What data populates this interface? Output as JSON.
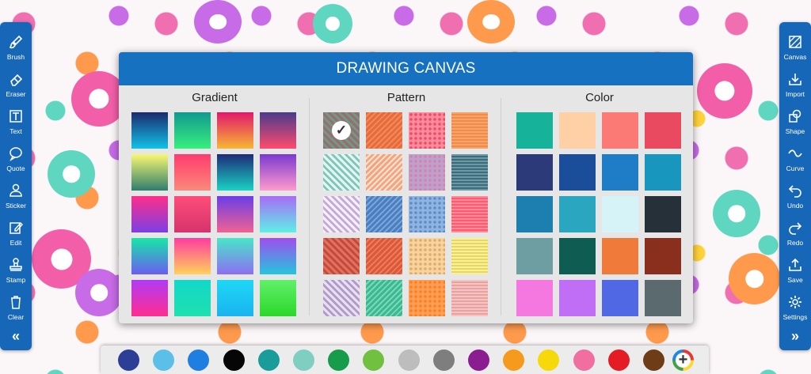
{
  "dialog": {
    "title": "DRAWING CANVAS"
  },
  "left_tools": [
    {
      "label": "Brush",
      "icon": "brush-icon"
    },
    {
      "label": "Eraser",
      "icon": "eraser-icon"
    },
    {
      "label": "Text",
      "icon": "text-icon"
    },
    {
      "label": "Quote",
      "icon": "quote-icon"
    },
    {
      "label": "Sticker",
      "icon": "sticker-icon"
    },
    {
      "label": "Edit",
      "icon": "edit-icon"
    },
    {
      "label": "Stamp",
      "icon": "stamp-icon"
    },
    {
      "label": "Clear",
      "icon": "trash-icon"
    }
  ],
  "right_tools": [
    {
      "label": "Canvas",
      "icon": "canvas-icon"
    },
    {
      "label": "Import",
      "icon": "import-icon"
    },
    {
      "label": "Shape",
      "icon": "shape-icon"
    },
    {
      "label": "Curve",
      "icon": "curve-icon"
    },
    {
      "label": "Undo",
      "icon": "undo-icon"
    },
    {
      "label": "Redo",
      "icon": "redo-icon"
    },
    {
      "label": "Save",
      "icon": "save-icon"
    },
    {
      "label": "Settings",
      "icon": "gear-icon"
    }
  ],
  "collapse_left": "«",
  "collapse_right": "»",
  "panels": {
    "gradient": {
      "title": "Gradient",
      "swatches": [
        [
          "#1a2a6c",
          "#12c2e9"
        ],
        [
          "#11998e",
          "#38ef7d"
        ],
        [
          "#e0186c",
          "#f7b733"
        ],
        [
          "#4a3a8a",
          "#ff4b6e"
        ],
        [
          "#f9f871",
          "#2e7d6e"
        ],
        [
          "#ff3c6e",
          "#f98a7a"
        ],
        [
          "#1e2a78",
          "#19d3c5"
        ],
        [
          "#7a3ad0",
          "#ff9acb"
        ],
        [
          "#ff2e8a",
          "#7b3fe4"
        ],
        [
          "#ff4d7a",
          "#d6336c"
        ],
        [
          "#6a3de8",
          "#f06292"
        ],
        [
          "#a86bf5",
          "#5ef0e6"
        ],
        [
          "#18e6a8",
          "#6b5cf0"
        ],
        [
          "#ff3ca0",
          "#ffd25a"
        ],
        [
          "#48e6c8",
          "#8e6df2"
        ],
        [
          "#a04df0",
          "#24c6dc"
        ],
        [
          "#b13af5",
          "#ff2e8f"
        ],
        [
          "#13d8c8",
          "#1ee0b0"
        ],
        [
          "#1fd7f5",
          "#19b4f0"
        ],
        [
          "#62f06a",
          "#2bd82a"
        ]
      ]
    },
    "pattern": {
      "title": "Pattern",
      "selected_index": 0,
      "swatches": [
        [
          "#9c6b6b",
          "#6b9c8a"
        ],
        [
          "#f08a5a",
          "#e76b3a"
        ],
        [
          "#ff8a9a",
          "#e94b68"
        ],
        [
          "#f6a56a",
          "#f28a4a"
        ],
        [
          "#e8f4f2",
          "#7ac8b8"
        ],
        [
          "#fde3d6",
          "#f3a67e"
        ],
        [
          "#b8a2cf",
          "#e07da0"
        ],
        [
          "#6a9aa8",
          "#3f6b78"
        ],
        [
          "#f4f0f6",
          "#c4a8d8"
        ],
        [
          "#7aa6d8",
          "#4a7ec0"
        ],
        [
          "#8fb4e0",
          "#5b8cc8"
        ],
        [
          "#ff8a9a",
          "#ff5a70"
        ],
        [
          "#e07060",
          "#c24a3a"
        ],
        [
          "#f07a5a",
          "#d85a3a"
        ],
        [
          "#f4d4a0",
          "#e8a860"
        ],
        [
          "#f8f0a0",
          "#e8d85a"
        ],
        [
          "#e8e0f0",
          "#b09ac8"
        ],
        [
          "#7ad8b8",
          "#3ab890"
        ],
        [
          "#ffa050",
          "#ff7a2a"
        ],
        [
          "#f4c4c0",
          "#e8a0a0"
        ]
      ]
    },
    "color": {
      "title": "Color",
      "swatches": [
        "#16b39a",
        "#ffcfa6",
        "#fb7a75",
        "#ea4a5f",
        "#2c3a7a",
        "#1a4e9a",
        "#1f7cc6",
        "#1896be",
        "#1c7fb0",
        "#2aa6c0",
        "#d6f4f8",
        "#263039",
        "#6e9ea2",
        "#0e5c52",
        "#f07a3a",
        "#8a2e1e",
        "#f577e0",
        "#c06ef5",
        "#5068e4",
        "#5a6a6e"
      ]
    }
  },
  "palette_colors": [
    "#2c3e96",
    "#5bbfe8",
    "#1e7fe0",
    "#060606",
    "#1a9d9a",
    "#7fcfc0",
    "#169c4a",
    "#72c040",
    "#bdbdbd",
    "#7e7e7e",
    "#8a1d90",
    "#f59a1c",
    "#f7d80a",
    "#f06ea0",
    "#e41d24",
    "#6e3d18"
  ]
}
